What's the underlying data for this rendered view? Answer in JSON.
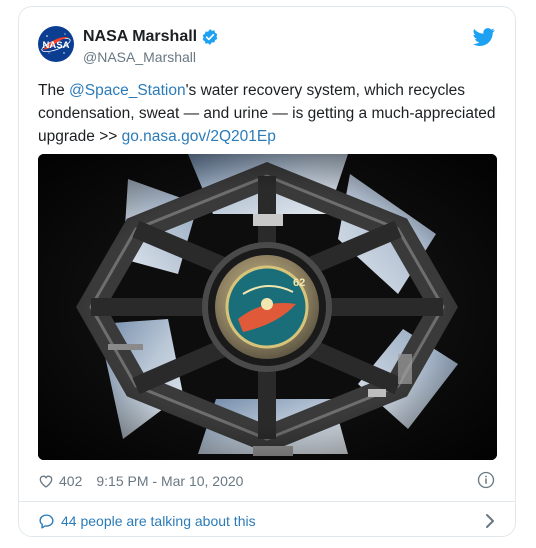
{
  "account": {
    "name": "NASA Marshall",
    "handle": "@NASA_Marshall",
    "logo_text": "NASA"
  },
  "tweet": {
    "text_prefix": "The ",
    "mention": "@Space_Station",
    "text_middle": "'s water recovery system, which recycles condensation, sweat — and urine — is getting a much-appreciated upgrade >> ",
    "link": "go.nasa.gov/2Q201Ep"
  },
  "photo": {
    "patch_number": "62"
  },
  "stats": {
    "likes": "402",
    "timestamp": "9:15 PM - Mar 10, 2020"
  },
  "footer": {
    "talking": "44 people are talking about this"
  },
  "colors": {
    "link": "#2b7bb9",
    "twitter_blue": "#1da1f2",
    "muted": "#697882",
    "nasa_blue": "#0b3d91",
    "nasa_red": "#fc3d21"
  },
  "icons": {
    "verified": "verified-badge-icon",
    "bird": "twitter-bird-icon",
    "like": "heart-icon",
    "info": "info-icon",
    "reply": "speech-bubble-icon",
    "next": "chevron-right-icon"
  }
}
